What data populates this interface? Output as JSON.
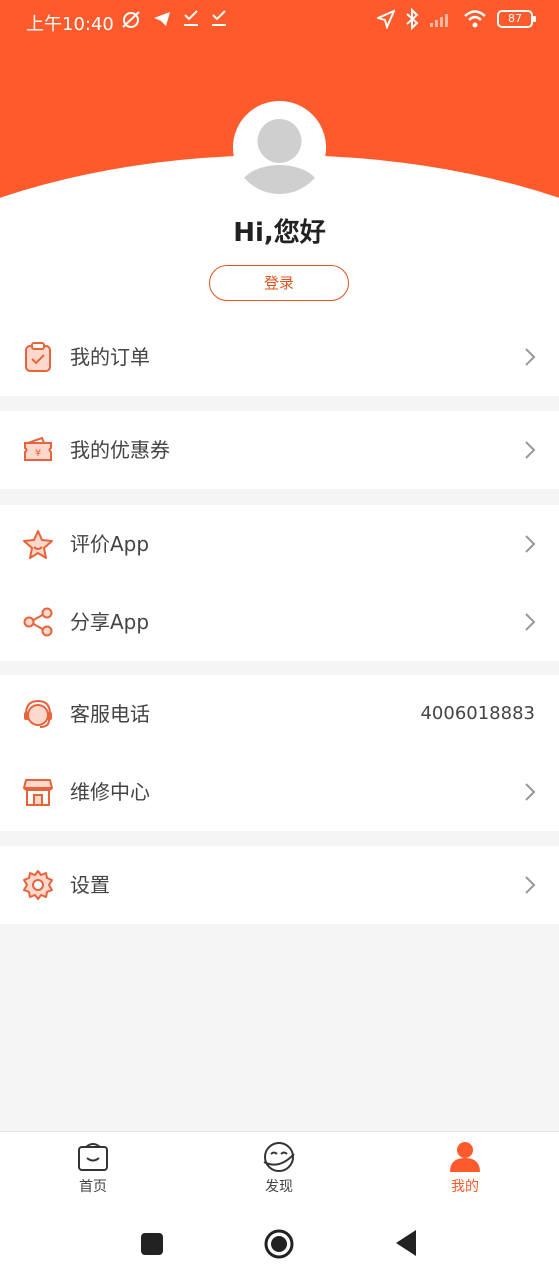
{
  "status_bar": {
    "time": "上午10:40",
    "battery": "87"
  },
  "profile": {
    "greeting": "Hi,您好",
    "login_label": "登录"
  },
  "menu": {
    "orders": "我的订单",
    "coupons": "我的优惠券",
    "rate_app": "评价App",
    "share_app": "分享App",
    "service_phone": "客服电话",
    "service_phone_value": "4006018883",
    "repair_center": "维修中心",
    "settings": "设置"
  },
  "bottom_nav": {
    "home": "首页",
    "discover": "发现",
    "mine": "我的"
  },
  "colors": {
    "accent": "#ff5a2c",
    "icon_stroke": "#e8623a",
    "icon_fill": "#fcd9cc"
  }
}
